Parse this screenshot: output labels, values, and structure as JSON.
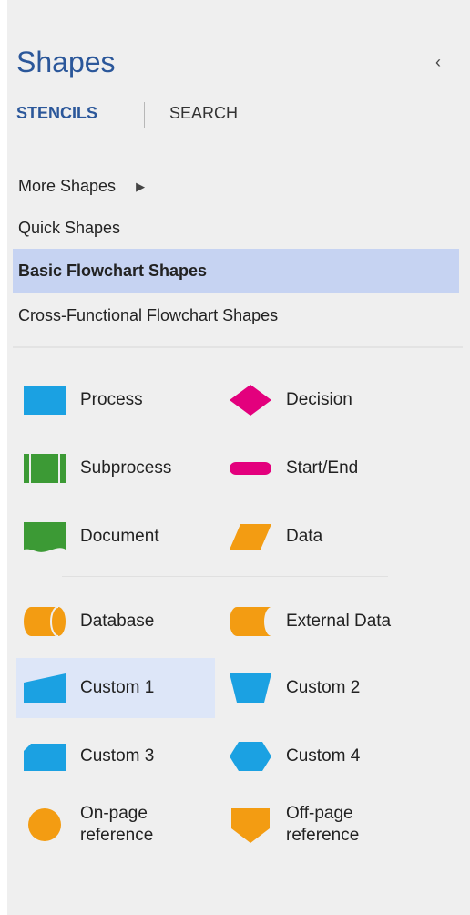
{
  "panel": {
    "title": "Shapes",
    "collapse_glyph": "‹"
  },
  "tabs": {
    "stencils": "STENCILS",
    "search": "SEARCH"
  },
  "stencils": [
    {
      "label": "More Shapes",
      "has_submenu": true
    },
    {
      "label": "Quick Shapes"
    },
    {
      "label": "Basic Flowchart Shapes",
      "selected": true
    },
    {
      "label": "Cross-Functional Flowchart Shapes"
    }
  ],
  "shapes": [
    {
      "label": "Process",
      "icon": "process-icon",
      "color": "#1ba1e2"
    },
    {
      "label": "Decision",
      "icon": "decision-icon",
      "color": "#e3007d"
    },
    {
      "label": "Subprocess",
      "icon": "subprocess-icon",
      "color": "#3c9a35"
    },
    {
      "label": "Start/End",
      "icon": "start-end-icon",
      "color": "#e3007d"
    },
    {
      "label": "Document",
      "icon": "document-icon",
      "color": "#3c9a35"
    },
    {
      "label": "Data",
      "icon": "data-icon",
      "color": "#f39c12"
    },
    {
      "label": "Database",
      "icon": "database-icon",
      "color": "#f39c12"
    },
    {
      "label": "External Data",
      "icon": "external-data-icon",
      "color": "#f39c12"
    },
    {
      "label": "Custom 1",
      "icon": "custom-1-icon",
      "color": "#1ba1e2",
      "hovered": true
    },
    {
      "label": "Custom 2",
      "icon": "custom-2-icon",
      "color": "#1ba1e2"
    },
    {
      "label": "Custom 3",
      "icon": "custom-3-icon",
      "color": "#1ba1e2"
    },
    {
      "label": "Custom 4",
      "icon": "custom-4-icon",
      "color": "#1ba1e2"
    },
    {
      "label": "On-page\nreference",
      "icon": "on-page-reference-icon",
      "color": "#f39c12"
    },
    {
      "label": "Off-page\nreference",
      "icon": "off-page-reference-icon",
      "color": "#f39c12"
    }
  ]
}
